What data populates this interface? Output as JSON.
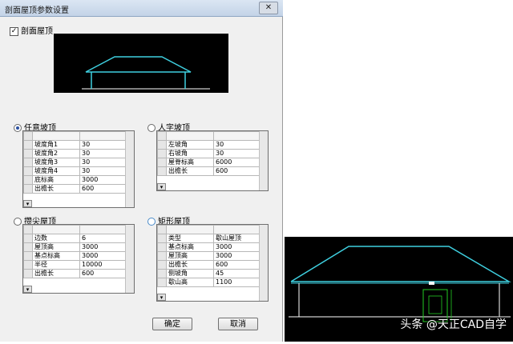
{
  "window": {
    "title": "剖面屋顶参数设置",
    "close_glyph": "✕"
  },
  "section_roof_checkbox": {
    "label": "剖面屋顶",
    "checked": true,
    "mark": "✓"
  },
  "panels": {
    "arbitrary_slope": {
      "label": "任意坡顶",
      "selected": true,
      "rows": [
        [
          "坡度角1",
          "30"
        ],
        [
          "坡度角2",
          "30"
        ],
        [
          "坡度角3",
          "30"
        ],
        [
          "坡度角4",
          "30"
        ],
        [
          "底标高",
          "3000"
        ],
        [
          "出檐长",
          "600"
        ]
      ]
    },
    "gable": {
      "label": "人字坡顶",
      "selected": false,
      "rows": [
        [
          "左坡角",
          "30"
        ],
        [
          "右坡角",
          "30"
        ],
        [
          "屋脊标高",
          "6000"
        ],
        [
          "出檐长",
          "600"
        ]
      ]
    },
    "pyramid": {
      "label": "攒尖屋顶",
      "selected": false,
      "rows": [
        [
          "边数",
          "6"
        ],
        [
          "屋顶高",
          "3000"
        ],
        [
          "基点标高",
          "3000"
        ],
        [
          "半径",
          "10000"
        ],
        [
          "出檐长",
          "600"
        ]
      ]
    },
    "rectangular": {
      "label": "矩形屋顶",
      "selected": false,
      "rows": [
        [
          "类型",
          "歇山屋顶"
        ],
        [
          "基点标高",
          "3000"
        ],
        [
          "屋顶高",
          "3000"
        ],
        [
          "出檐长",
          "600"
        ],
        [
          "侧坡角",
          "45"
        ],
        [
          "歇山高",
          "1100"
        ]
      ]
    }
  },
  "dropdown_glyph": "▾",
  "buttons": {
    "ok": "确定",
    "cancel": "取消"
  },
  "watermark": "头条 @天正CAD自学",
  "colors": {
    "roof_line": "#3fd0e0",
    "ground_line": "#ffffff",
    "door_line": "#22cc22"
  }
}
